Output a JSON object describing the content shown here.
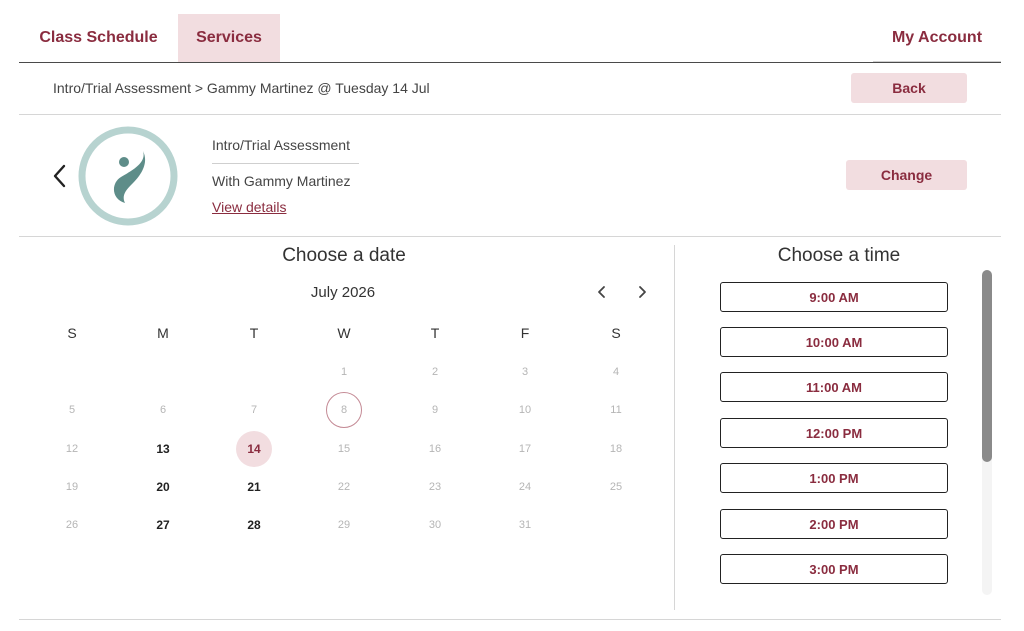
{
  "nav": {
    "tabs": [
      {
        "label": "Class Schedule"
      },
      {
        "label": "Services"
      }
    ],
    "account": "My Account"
  },
  "breadcrumb": "Intro/Trial Assessment > Gammy Martinez @ Tuesday 14 Jul",
  "back_label": "Back",
  "service": {
    "title": "Intro/Trial Assessment",
    "with": "With Gammy Martinez",
    "details_link": "View details",
    "change_label": "Change"
  },
  "calendar": {
    "title": "Choose a date",
    "month": "July 2026",
    "weekdays": [
      "S",
      "M",
      "T",
      "W",
      "T",
      "F",
      "S"
    ],
    "weeks": [
      [
        "",
        "",
        "",
        "1",
        "2",
        "3",
        "4"
      ],
      [
        "5",
        "6",
        "7",
        "8",
        "9",
        "10",
        "11"
      ],
      [
        "12",
        "13",
        "14",
        "15",
        "16",
        "17",
        "18"
      ],
      [
        "19",
        "20",
        "21",
        "22",
        "23",
        "24",
        "25"
      ],
      [
        "26",
        "27",
        "28",
        "29",
        "30",
        "31",
        ""
      ]
    ],
    "available_days": [
      "13",
      "14",
      "20",
      "21",
      "27",
      "28"
    ],
    "selected_day": "14",
    "today": "8"
  },
  "times": {
    "title": "Choose a time",
    "slots": [
      "9:00 AM",
      "10:00 AM",
      "11:00 AM",
      "12:00 PM",
      "1:00 PM",
      "2:00 PM",
      "3:00 PM"
    ]
  },
  "colors": {
    "accent": "#8a2c3f",
    "accent_light": "#f2dde0",
    "logo_ring": "#b7d3d0",
    "logo_figure": "#5e8d89"
  },
  "icons": {
    "prev_service": "chevron-left-icon",
    "prev_month": "chevron-left-icon",
    "next_month": "chevron-right-icon",
    "logo": "studio-logo"
  }
}
